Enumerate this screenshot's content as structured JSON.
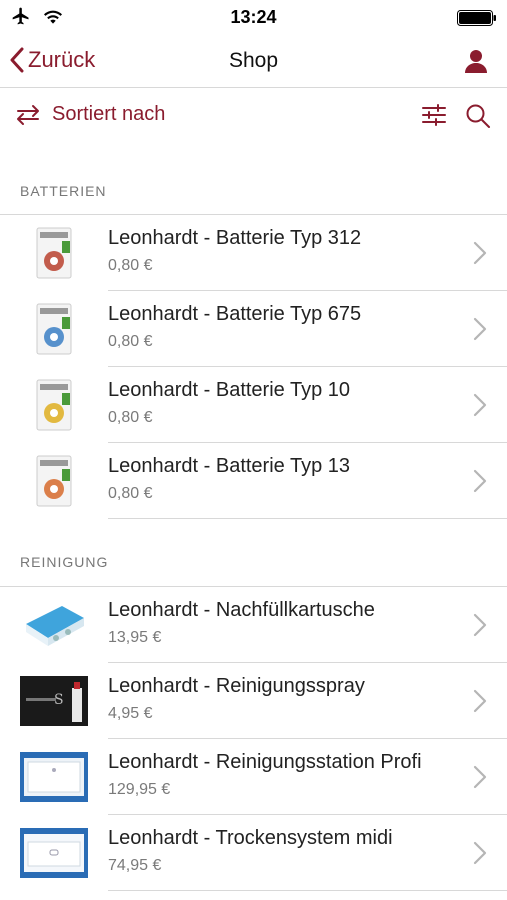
{
  "status": {
    "time": "13:24"
  },
  "nav": {
    "back_label": "Zurück",
    "title": "Shop"
  },
  "toolbar": {
    "sort_label": "Sortiert nach"
  },
  "sections": [
    {
      "title": "BATTERIEN",
      "items": [
        {
          "name": "Leonhardt - Batterie Typ 312",
          "price": "0,80 €",
          "accent": "#b8412e"
        },
        {
          "name": "Leonhardt - Batterie Typ 675",
          "price": "0,80 €",
          "accent": "#3b7fc4"
        },
        {
          "name": "Leonhardt - Batterie Typ 10",
          "price": "0,80 €",
          "accent": "#e0b22c"
        },
        {
          "name": "Leonhardt - Batterie Typ 13",
          "price": "0,80 €",
          "accent": "#d66a2c"
        }
      ]
    },
    {
      "title": "REINIGUNG",
      "items": [
        {
          "name": "Leonhardt - Nachfüllkartusche",
          "price": "13,95 €"
        },
        {
          "name": "Leonhardt - Reinigungsspray",
          "price": "4,95 €"
        },
        {
          "name": "Leonhardt - Reinigungsstation Profi",
          "price": "129,95 €"
        },
        {
          "name": "Leonhardt - Trockensystem midi",
          "price": "74,95 €"
        }
      ]
    }
  ],
  "colors": {
    "accent": "#8a1c2e",
    "separator": "#d8d8d8"
  }
}
